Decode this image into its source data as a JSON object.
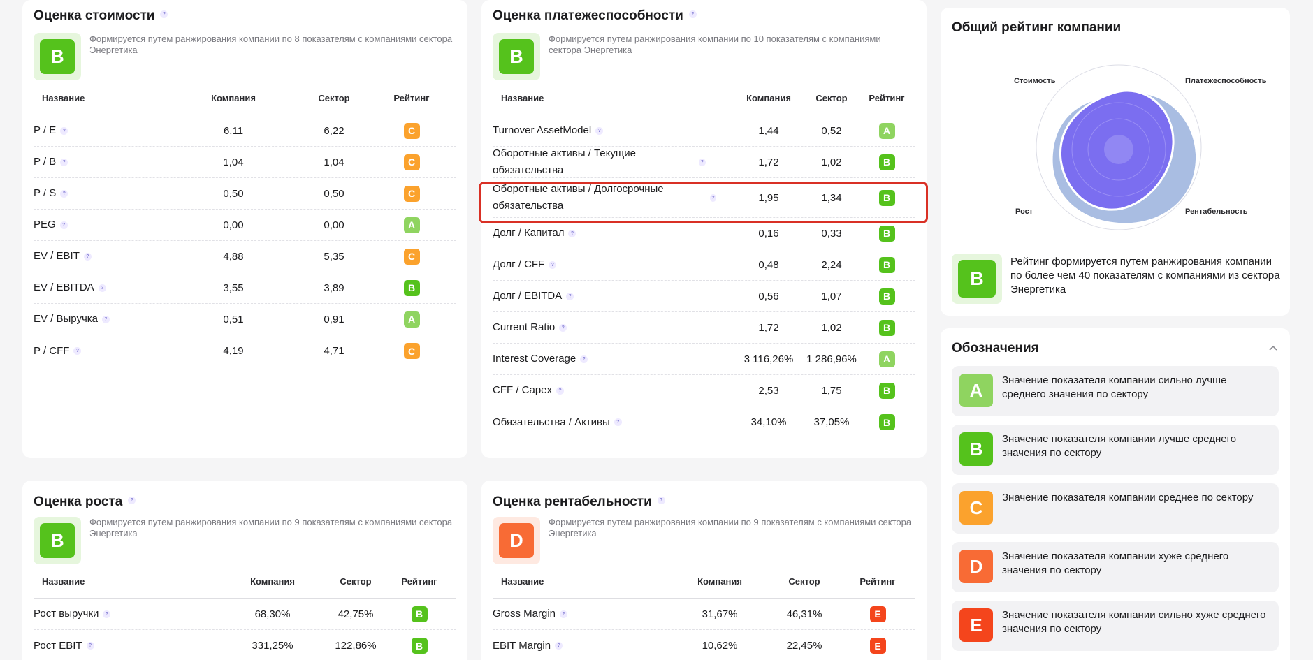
{
  "colors": {
    "A": "#8fd460",
    "B": "#55c21c",
    "C": "#fba22d",
    "D": "#f86b35",
    "E": "#f4451c"
  },
  "labels": {
    "name": "Название",
    "company": "Компания",
    "sector": "Сектор",
    "rating": "Рейтинг",
    "help": "?"
  },
  "valuation": {
    "title": "Оценка стоимости",
    "grade": "B",
    "description": "Формируется путем ранжирования компании по 8 показателям с компаниями сектора Энергетика",
    "rows": [
      {
        "name": "P / E",
        "company": "6,11",
        "sector": "6,22",
        "rating": "C"
      },
      {
        "name": "P / B",
        "company": "1,04",
        "sector": "1,04",
        "rating": "C"
      },
      {
        "name": "P / S",
        "company": "0,50",
        "sector": "0,50",
        "rating": "C"
      },
      {
        "name": "PEG",
        "company": "0,00",
        "sector": "0,00",
        "rating": "A"
      },
      {
        "name": "EV / EBIT",
        "company": "4,88",
        "sector": "5,35",
        "rating": "C"
      },
      {
        "name": "EV / EBITDA",
        "company": "3,55",
        "sector": "3,89",
        "rating": "B"
      },
      {
        "name": "EV / Выручка",
        "company": "0,51",
        "sector": "0,91",
        "rating": "A"
      },
      {
        "name": "P / CFF",
        "company": "4,19",
        "sector": "4,71",
        "rating": "C"
      }
    ]
  },
  "solvency": {
    "title": "Оценка платежеспособности",
    "grade": "B",
    "description": "Формируется путем ранжирования компании по 10 показателям с компаниями сектора Энергетика",
    "rows": [
      {
        "name": "Turnover AssetModel",
        "company": "1,44",
        "sector": "0,52",
        "rating": "A"
      },
      {
        "name": "Оборотные активы / Текущие обязательства",
        "company": "1,72",
        "sector": "1,02",
        "rating": "B"
      },
      {
        "name": "Оборотные активы / Долгосрочные обязательства",
        "company": "1,95",
        "sector": "1,34",
        "rating": "B"
      },
      {
        "name": "Долг / Капитал",
        "company": "0,16",
        "sector": "0,33",
        "rating": "B"
      },
      {
        "name": "Долг / CFF",
        "company": "0,48",
        "sector": "2,24",
        "rating": "B"
      },
      {
        "name": "Долг / EBITDA",
        "company": "0,56",
        "sector": "1,07",
        "rating": "B"
      },
      {
        "name": "Current Ratio",
        "company": "1,72",
        "sector": "1,02",
        "rating": "B"
      },
      {
        "name": "Interest Coverage",
        "company": "3 116,26%",
        "sector": "1 286,96%",
        "rating": "A"
      },
      {
        "name": "CFF / Capex",
        "company": "2,53",
        "sector": "1,75",
        "rating": "B"
      },
      {
        "name": "Обязательства / Активы",
        "company": "34,10%",
        "sector": "37,05%",
        "rating": "B"
      }
    ]
  },
  "growth": {
    "title": "Оценка роста",
    "grade": "B",
    "description": "Формируется путем ранжирования компании по 9 показателям с компаниями сектора Энергетика",
    "rows": [
      {
        "name": "Рост выручки",
        "company": "68,30%",
        "sector": "42,75%",
        "rating": "B"
      },
      {
        "name": "Рост EBIT",
        "company": "331,25%",
        "sector": "122,86%",
        "rating": "B"
      }
    ]
  },
  "profitability": {
    "title": "Оценка рентабельности",
    "grade": "D",
    "description": "Формируется путем ранжирования компании по 9 показателям с компаниями сектора Энергетика",
    "rows": [
      {
        "name": "Gross Margin",
        "company": "31,67%",
        "sector": "46,31%",
        "rating": "E"
      },
      {
        "name": "EBIT Margin",
        "company": "10,62%",
        "sector": "22,45%",
        "rating": "E"
      }
    ]
  },
  "overall": {
    "title": "Общий рейтинг компании",
    "grade": "B",
    "description": "Рейтинг формируется путем ранжирования компании по более чем 40 показателям с компаниями из сектора Энергетика",
    "radar_labels": {
      "valuation": "Стоимость",
      "solvency": "Платежеспособность",
      "growth": "Рост",
      "profitability": "Рентабельность"
    }
  },
  "legend": {
    "title": "Обозначения",
    "items": [
      {
        "grade": "A",
        "text": "Значение показателя компании сильно лучше среднего значения по сектору"
      },
      {
        "grade": "B",
        "text": "Значение показателя компании лучше среднего значения по сектору"
      },
      {
        "grade": "C",
        "text": "Значение показателя компании среднее по сектору"
      },
      {
        "grade": "D",
        "text": "Значение показателя компании хуже среднего значения по сектору"
      },
      {
        "grade": "E",
        "text": "Значение показателя компании сильно хуже среднего значения по сектору"
      }
    ]
  }
}
